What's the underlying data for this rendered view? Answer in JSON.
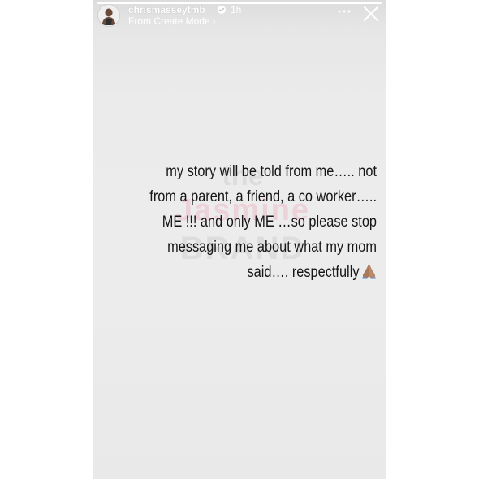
{
  "story": {
    "progress_fraction": 1.0,
    "header": {
      "username": "chrismasseytmb",
      "time": "1h",
      "subtitle": "From Create Mode",
      "subtitle_chevron": "›",
      "avatar_icon": "profile-avatar",
      "verified_icon": "verified-badge-icon",
      "more_icon": "more-horizontal-icon",
      "close_icon": "close-icon"
    },
    "watermark": {
      "line1": "the",
      "line2": "Jasmine",
      "line3": "BRAND"
    },
    "message_lines": [
      "my story will be told from me….. not",
      "from a parent,  a friend, a co worker…..",
      "ME !!! and only ME …so please stop",
      "messaging me about what my mom",
      "said…. respectfully"
    ],
    "message_emoji": "folded-hands-icon",
    "colors": {
      "background": "#ebebeb",
      "text": "#161616",
      "header_text": "#ffffff"
    }
  }
}
